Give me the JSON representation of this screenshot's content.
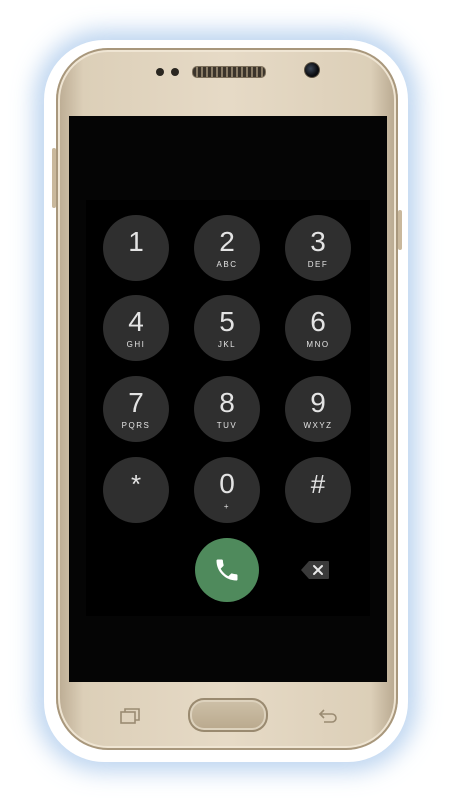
{
  "dialer": {
    "keys": [
      {
        "digit": "1",
        "letters": ""
      },
      {
        "digit": "2",
        "letters": "ABC"
      },
      {
        "digit": "3",
        "letters": "DEF"
      },
      {
        "digit": "4",
        "letters": "GHI"
      },
      {
        "digit": "5",
        "letters": "JKL"
      },
      {
        "digit": "6",
        "letters": "MNO"
      },
      {
        "digit": "7",
        "letters": "PQRS"
      },
      {
        "digit": "8",
        "letters": "TUV"
      },
      {
        "digit": "9",
        "letters": "WXYZ"
      },
      {
        "digit": "*",
        "letters": ""
      },
      {
        "digit": "0",
        "letters": "+"
      },
      {
        "digit": "#",
        "letters": ""
      }
    ]
  },
  "colors": {
    "key_background": "#2f2f2f",
    "call_button": "#4f8a5c",
    "phone_body": "#e6dac6",
    "screen": "#050505"
  },
  "icons": {
    "call": "phone-handset-icon",
    "backspace": "backspace-icon",
    "recents": "recent-apps-icon",
    "back": "back-arrow-icon"
  }
}
